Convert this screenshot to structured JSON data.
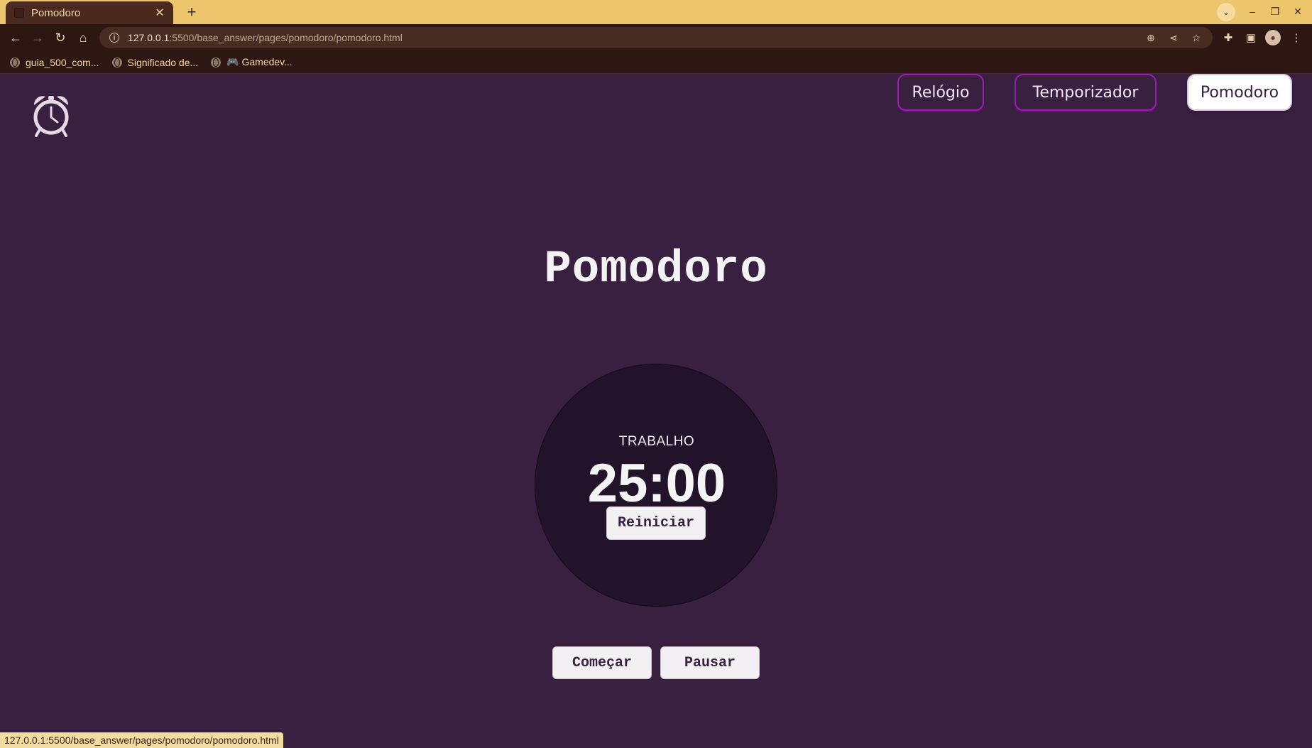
{
  "browser": {
    "tab_title": "Pomodoro",
    "url_host": "127.0.0.1",
    "url_path": ":5500/base_answer/pages/pomodoro/pomodoro.html",
    "bookmarks": [
      {
        "label": "guia_500_com...",
        "icon": "globe-icon"
      },
      {
        "label": "Significado de...",
        "icon": "globe-icon"
      },
      {
        "label": "🎮 Gamedev...",
        "icon": "globe-icon"
      }
    ],
    "status_url": "127.0.0.1:5500/base_answer/pages/pomodoro/pomodoro.html"
  },
  "header": {
    "logo_icon": "alarm-clock-icon",
    "nav": [
      {
        "label": "Relógio",
        "active": false
      },
      {
        "label": "Temporizador",
        "active": false
      },
      {
        "label": "Pomodoro",
        "active": true
      }
    ]
  },
  "main": {
    "title": "Pomodoro",
    "timer": {
      "mode": "TRABALHO",
      "time": "25:00",
      "reset_label": "Reiniciar"
    },
    "controls": {
      "start_label": "Começar",
      "pause_label": "Pausar"
    }
  },
  "colors": {
    "page_background": "#3a2040",
    "circle_background": "#22132a",
    "nav_border": "#9a1fb0",
    "tabbar": "#ecc56c"
  }
}
